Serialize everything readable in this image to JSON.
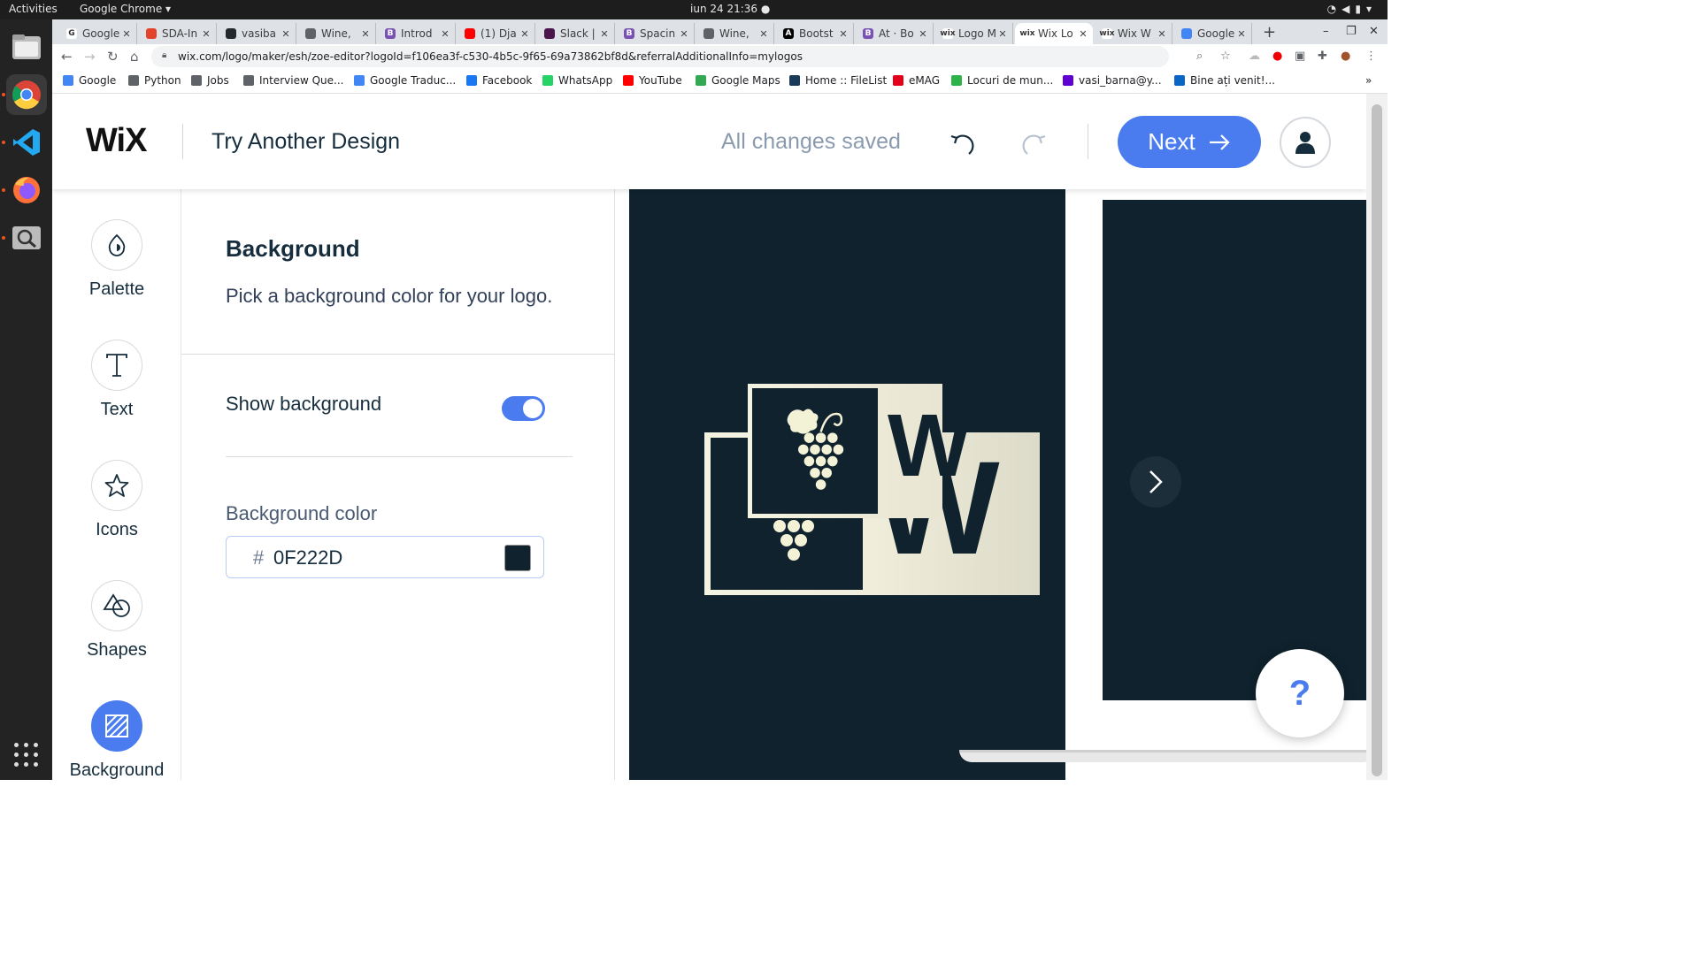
{
  "os": {
    "activities": "Activities",
    "app_menu": "Google Chrome ▾",
    "clock": "iun 24  21:36  ●"
  },
  "browser": {
    "tabs": [
      {
        "label": "Google",
        "icon_color": "#ffffff",
        "glyph": "G"
      },
      {
        "label": "SDA-In",
        "icon_color": "#e24329",
        "glyph": ""
      },
      {
        "label": "vasiba",
        "icon_color": "#24292e",
        "glyph": ""
      },
      {
        "label": "Wine, ",
        "icon_color": "#5f6368",
        "glyph": ""
      },
      {
        "label": "Introd",
        "icon_color": "#7952b3",
        "glyph": "B"
      },
      {
        "label": "(1) Dja",
        "icon_color": "#ff0000",
        "glyph": ""
      },
      {
        "label": "Slack |",
        "icon_color": "#4a154b",
        "glyph": ""
      },
      {
        "label": "Spacin",
        "icon_color": "#7952b3",
        "glyph": "B"
      },
      {
        "label": "Wine, ",
        "icon_color": "#5f6368",
        "glyph": ""
      },
      {
        "label": "Bootst",
        "icon_color": "#000000",
        "glyph": "A"
      },
      {
        "label": "At · Bo",
        "icon_color": "#7952b3",
        "glyph": "B"
      },
      {
        "label": "Logo M",
        "icon_color": "#ffffff",
        "glyph": "wix"
      },
      {
        "label": "Wix Lo",
        "icon_color": "#ffffff",
        "glyph": "wix"
      },
      {
        "label": "Wix W",
        "icon_color": "#ffffff",
        "glyph": "wix"
      },
      {
        "label": "Google",
        "icon_color": "#4285f4",
        "glyph": ""
      }
    ],
    "active_tab_index": 12,
    "url": "wix.com/logo/maker/esh/zoe-editor?logoId=f106ea3f-c530-4b5c-9f65-69a73862bf8d&referralAdditionalInfo=mylogos",
    "bookmarks": [
      {
        "label": "Google",
        "color": "#4285f4"
      },
      {
        "label": "Python",
        "color": "#5f6368"
      },
      {
        "label": "Jobs",
        "color": "#5f6368"
      },
      {
        "label": "Interview Que...",
        "color": "#5f6368"
      },
      {
        "label": "Google Traduc...",
        "color": "#4285f4"
      },
      {
        "label": "Facebook",
        "color": "#1877f2"
      },
      {
        "label": "WhatsApp",
        "color": "#25d366"
      },
      {
        "label": "YouTube",
        "color": "#ff0000"
      },
      {
        "label": "Google Maps",
        "color": "#34a853"
      },
      {
        "label": "Home :: FileList",
        "color": "#1a3a5a"
      },
      {
        "label": "eMAG",
        "color": "#e2001a"
      },
      {
        "label": "Locuri de mun...",
        "color": "#2db34a"
      },
      {
        "label": "vasi_barna@y...",
        "color": "#6001d2"
      },
      {
        "label": "Bine ați venit!...",
        "color": "#0a66c2"
      }
    ]
  },
  "wix": {
    "logo": "WiX",
    "title": "Try Another Design",
    "status": "All changes saved",
    "next_label": "Next",
    "accent": "#4a7cf0",
    "nav": [
      {
        "label": "Palette",
        "icon": "palette-icon"
      },
      {
        "label": "Text",
        "icon": "text-icon"
      },
      {
        "label": "Icons",
        "icon": "star-icon"
      },
      {
        "label": "Shapes",
        "icon": "shapes-icon"
      },
      {
        "label": "Background",
        "icon": "background-icon"
      }
    ],
    "panel": {
      "title": "Background",
      "subtitle": "Pick a background color for your logo.",
      "toggle_label": "Show background",
      "toggle_on": true,
      "color_label": "Background color",
      "hash": "#",
      "hex_value": "0F222D",
      "swatch": "#0F222D"
    },
    "preview": {
      "letter": "W",
      "letter_partial": "W",
      "help": "?"
    }
  }
}
